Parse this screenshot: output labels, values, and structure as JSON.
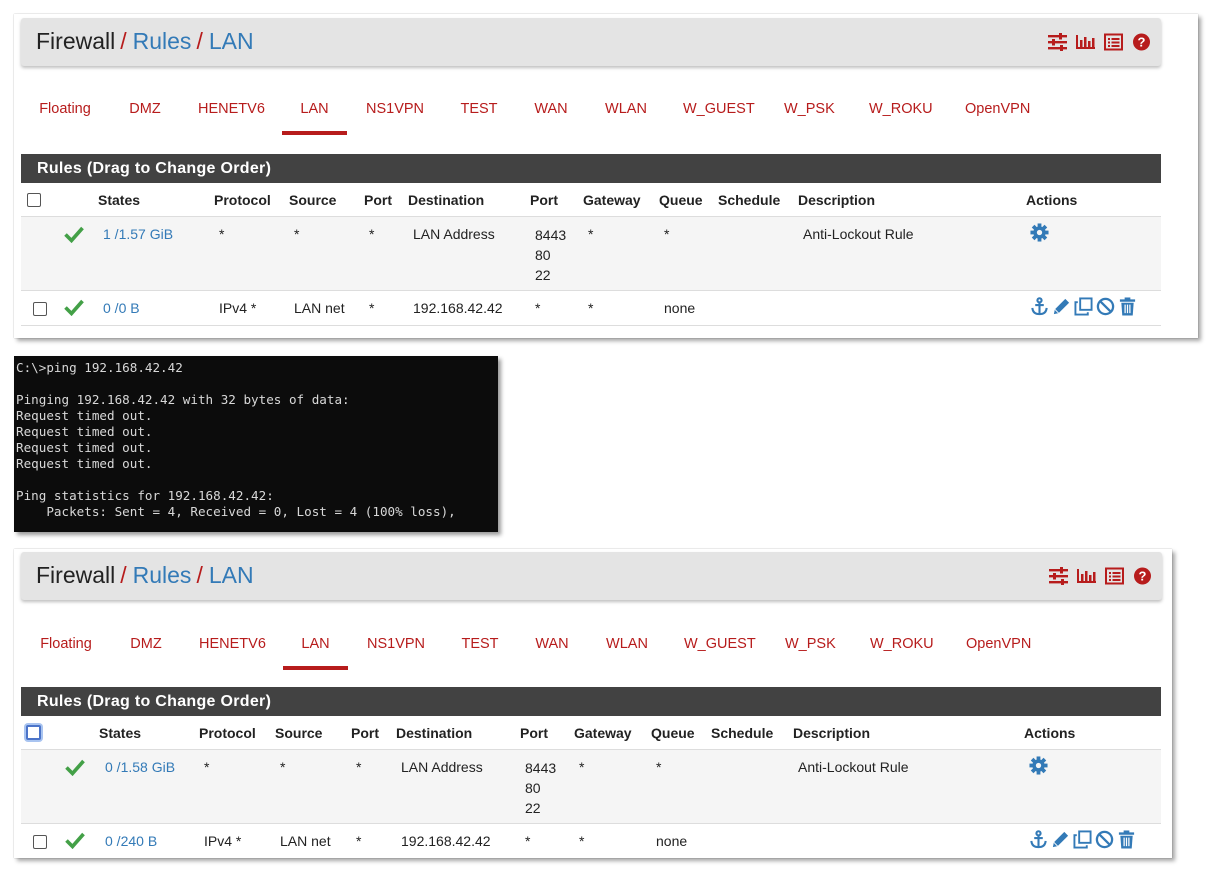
{
  "shots": [
    {
      "breadcrumb": [
        "Firewall",
        "Rules",
        "LAN"
      ],
      "tabs": [
        "Floating",
        "DMZ",
        "HENETV6",
        "LAN",
        "NS1VPN",
        "TEST",
        "WAN",
        "WLAN",
        "W_GUEST",
        "W_PSK",
        "W_ROKU",
        "OpenVPN"
      ],
      "active_tab": "LAN",
      "panel_title": "Rules (Drag to Change Order)",
      "columns": [
        "States",
        "Protocol",
        "Source",
        "Port",
        "Destination",
        "Port",
        "Gateway",
        "Queue",
        "Schedule",
        "Description",
        "Actions"
      ],
      "rows": [
        {
          "states": "1 /1.57 GiB",
          "protocol": "*",
          "source": "*",
          "port": "*",
          "destination": "LAN Address",
          "dest_ports": [
            "8443",
            "80",
            "22"
          ],
          "gateway": "*",
          "queue": "*",
          "schedule": "",
          "description": "Anti-Lockout Rule"
        },
        {
          "states": "0 /0 B",
          "protocol": "IPv4 *",
          "source": "LAN net",
          "port": "*",
          "destination": "192.168.42.42",
          "dest_port": "*",
          "gateway": "*",
          "queue": "none",
          "schedule": "",
          "description": ""
        }
      ]
    },
    {
      "breadcrumb": [
        "Firewall",
        "Rules",
        "LAN"
      ],
      "tabs": [
        "Floating",
        "DMZ",
        "HENETV6",
        "LAN",
        "NS1VPN",
        "TEST",
        "WAN",
        "WLAN",
        "W_GUEST",
        "W_PSK",
        "W_ROKU",
        "OpenVPN"
      ],
      "active_tab": "LAN",
      "panel_title": "Rules (Drag to Change Order)",
      "columns": [
        "States",
        "Protocol",
        "Source",
        "Port",
        "Destination",
        "Port",
        "Gateway",
        "Queue",
        "Schedule",
        "Description",
        "Actions"
      ],
      "rows": [
        {
          "states": "0 /1.58 GiB",
          "protocol": "*",
          "source": "*",
          "port": "*",
          "destination": "LAN Address",
          "dest_ports": [
            "8443",
            "80",
            "22"
          ],
          "gateway": "*",
          "queue": "*",
          "schedule": "",
          "description": "Anti-Lockout Rule"
        },
        {
          "states": "0 /240 B",
          "protocol": "IPv4 *",
          "source": "LAN net",
          "port": "*",
          "destination": "192.168.42.42",
          "dest_port": "*",
          "gateway": "*",
          "queue": "none",
          "schedule": "",
          "description": ""
        }
      ]
    }
  ],
  "console": {
    "lines": [
      "C:\\>ping 192.168.42.42",
      "",
      "Pinging 192.168.42.42 with 32 bytes of data:",
      "Request timed out.",
      "Request timed out.",
      "Request timed out.",
      "Request timed out.",
      "",
      "Ping statistics for 192.168.42.42:",
      "    Packets: Sent = 4, Received = 0, Lost = 4 (100% loss),"
    ]
  },
  "icons": {
    "header": [
      "sliders-icon",
      "bar-chart-icon",
      "list-icon",
      "help-icon"
    ],
    "anti_lockout_action": "gear-icon",
    "rule_actions": [
      "anchor-icon",
      "pencil-icon",
      "copy-icon",
      "disable-icon",
      "trash-icon"
    ],
    "status": "check-icon"
  },
  "colors": {
    "accent_red": "#b71c1c",
    "link_blue": "#337ab7",
    "panel_header": "#424242",
    "check_green": "#43a047",
    "console_bg": "#0c0c0c"
  }
}
